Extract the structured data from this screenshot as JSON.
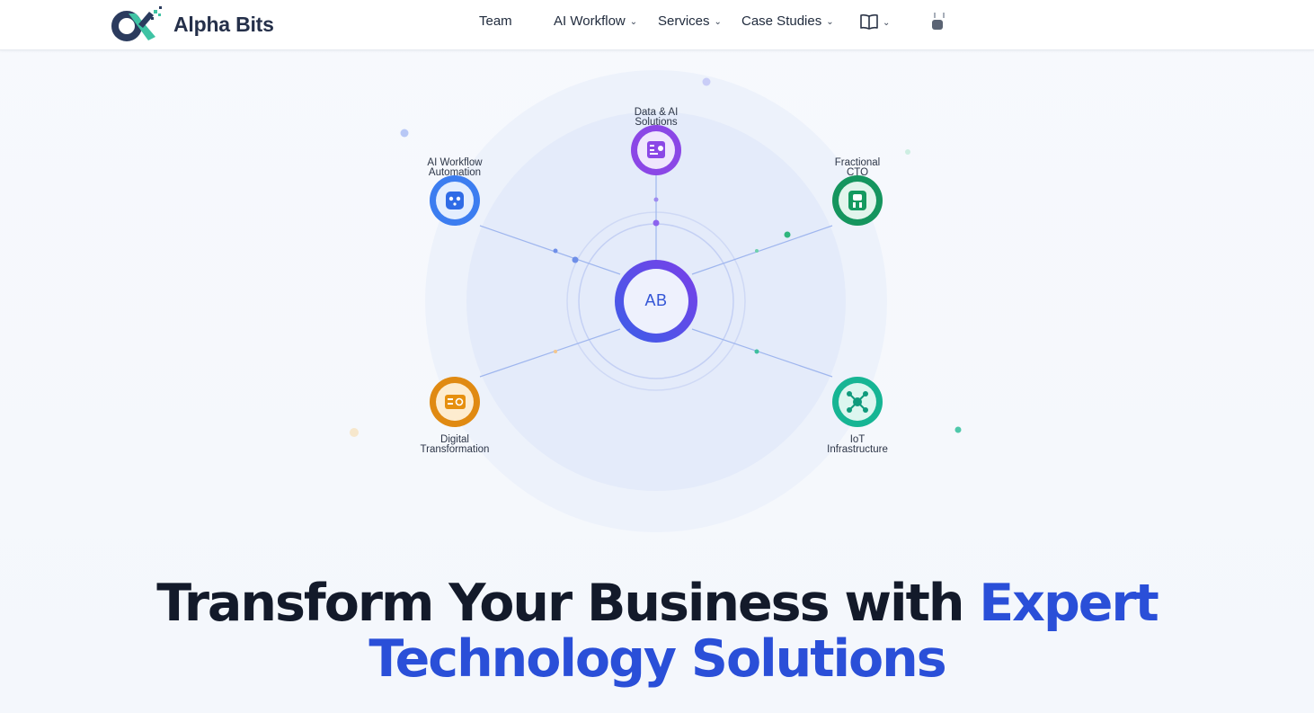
{
  "brand": {
    "name": "Alpha Bits"
  },
  "nav": {
    "items": [
      {
        "label": "Team",
        "has_dropdown": false
      },
      {
        "label": "AI Workflow",
        "has_dropdown": true
      },
      {
        "label": "Services",
        "has_dropdown": true
      },
      {
        "label": "Case Studies",
        "has_dropdown": true
      }
    ],
    "resources_icon": "book-open-icon",
    "extra_icon": "plug-icon"
  },
  "diagram": {
    "hub_label": "AB",
    "nodes": [
      {
        "label": "Data & AI\nSolutions",
        "icon": "document-icon",
        "color": "#8b47e6"
      },
      {
        "label": "AI Workflow\nAutomation",
        "icon": "robot-icon",
        "color": "#3c7df0"
      },
      {
        "label": "Fractional\nCTO",
        "icon": "cto-icon",
        "color": "#15955e"
      },
      {
        "label": "Digital\nTransformation",
        "icon": "transform-icon",
        "color": "#e08a12"
      },
      {
        "label": "IoT\nInfrastructure",
        "icon": "network-icon",
        "color": "#16b594"
      }
    ]
  },
  "hero": {
    "headline_part1": "Transform Your Business with ",
    "headline_part2": "Expert",
    "headline_line2": "Technology Solutions"
  },
  "colors": {
    "accent_blue": "#2a4fd8",
    "hub_gradient_start": "#3b5ee8",
    "hub_gradient_end": "#7a3fe8"
  }
}
